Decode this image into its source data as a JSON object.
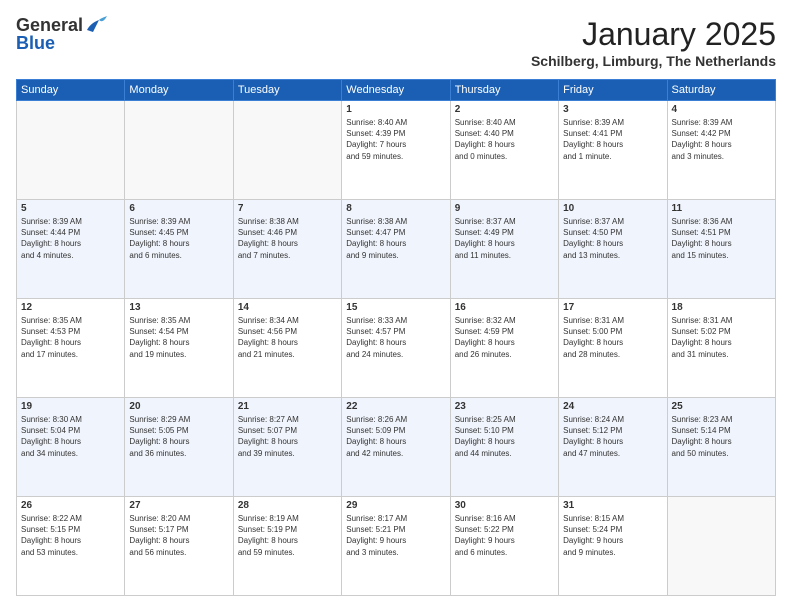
{
  "header": {
    "logo_line1": "General",
    "logo_line2": "Blue",
    "month": "January 2025",
    "location": "Schilberg, Limburg, The Netherlands"
  },
  "weekdays": [
    "Sunday",
    "Monday",
    "Tuesday",
    "Wednesday",
    "Thursday",
    "Friday",
    "Saturday"
  ],
  "weeks": [
    [
      {
        "day": "",
        "info": ""
      },
      {
        "day": "",
        "info": ""
      },
      {
        "day": "",
        "info": ""
      },
      {
        "day": "1",
        "info": "Sunrise: 8:40 AM\nSunset: 4:39 PM\nDaylight: 7 hours\nand 59 minutes."
      },
      {
        "day": "2",
        "info": "Sunrise: 8:40 AM\nSunset: 4:40 PM\nDaylight: 8 hours\nand 0 minutes."
      },
      {
        "day": "3",
        "info": "Sunrise: 8:39 AM\nSunset: 4:41 PM\nDaylight: 8 hours\nand 1 minute."
      },
      {
        "day": "4",
        "info": "Sunrise: 8:39 AM\nSunset: 4:42 PM\nDaylight: 8 hours\nand 3 minutes."
      }
    ],
    [
      {
        "day": "5",
        "info": "Sunrise: 8:39 AM\nSunset: 4:44 PM\nDaylight: 8 hours\nand 4 minutes."
      },
      {
        "day": "6",
        "info": "Sunrise: 8:39 AM\nSunset: 4:45 PM\nDaylight: 8 hours\nand 6 minutes."
      },
      {
        "day": "7",
        "info": "Sunrise: 8:38 AM\nSunset: 4:46 PM\nDaylight: 8 hours\nand 7 minutes."
      },
      {
        "day": "8",
        "info": "Sunrise: 8:38 AM\nSunset: 4:47 PM\nDaylight: 8 hours\nand 9 minutes."
      },
      {
        "day": "9",
        "info": "Sunrise: 8:37 AM\nSunset: 4:49 PM\nDaylight: 8 hours\nand 11 minutes."
      },
      {
        "day": "10",
        "info": "Sunrise: 8:37 AM\nSunset: 4:50 PM\nDaylight: 8 hours\nand 13 minutes."
      },
      {
        "day": "11",
        "info": "Sunrise: 8:36 AM\nSunset: 4:51 PM\nDaylight: 8 hours\nand 15 minutes."
      }
    ],
    [
      {
        "day": "12",
        "info": "Sunrise: 8:35 AM\nSunset: 4:53 PM\nDaylight: 8 hours\nand 17 minutes."
      },
      {
        "day": "13",
        "info": "Sunrise: 8:35 AM\nSunset: 4:54 PM\nDaylight: 8 hours\nand 19 minutes."
      },
      {
        "day": "14",
        "info": "Sunrise: 8:34 AM\nSunset: 4:56 PM\nDaylight: 8 hours\nand 21 minutes."
      },
      {
        "day": "15",
        "info": "Sunrise: 8:33 AM\nSunset: 4:57 PM\nDaylight: 8 hours\nand 24 minutes."
      },
      {
        "day": "16",
        "info": "Sunrise: 8:32 AM\nSunset: 4:59 PM\nDaylight: 8 hours\nand 26 minutes."
      },
      {
        "day": "17",
        "info": "Sunrise: 8:31 AM\nSunset: 5:00 PM\nDaylight: 8 hours\nand 28 minutes."
      },
      {
        "day": "18",
        "info": "Sunrise: 8:31 AM\nSunset: 5:02 PM\nDaylight: 8 hours\nand 31 minutes."
      }
    ],
    [
      {
        "day": "19",
        "info": "Sunrise: 8:30 AM\nSunset: 5:04 PM\nDaylight: 8 hours\nand 34 minutes."
      },
      {
        "day": "20",
        "info": "Sunrise: 8:29 AM\nSunset: 5:05 PM\nDaylight: 8 hours\nand 36 minutes."
      },
      {
        "day": "21",
        "info": "Sunrise: 8:27 AM\nSunset: 5:07 PM\nDaylight: 8 hours\nand 39 minutes."
      },
      {
        "day": "22",
        "info": "Sunrise: 8:26 AM\nSunset: 5:09 PM\nDaylight: 8 hours\nand 42 minutes."
      },
      {
        "day": "23",
        "info": "Sunrise: 8:25 AM\nSunset: 5:10 PM\nDaylight: 8 hours\nand 44 minutes."
      },
      {
        "day": "24",
        "info": "Sunrise: 8:24 AM\nSunset: 5:12 PM\nDaylight: 8 hours\nand 47 minutes."
      },
      {
        "day": "25",
        "info": "Sunrise: 8:23 AM\nSunset: 5:14 PM\nDaylight: 8 hours\nand 50 minutes."
      }
    ],
    [
      {
        "day": "26",
        "info": "Sunrise: 8:22 AM\nSunset: 5:15 PM\nDaylight: 8 hours\nand 53 minutes."
      },
      {
        "day": "27",
        "info": "Sunrise: 8:20 AM\nSunset: 5:17 PM\nDaylight: 8 hours\nand 56 minutes."
      },
      {
        "day": "28",
        "info": "Sunrise: 8:19 AM\nSunset: 5:19 PM\nDaylight: 8 hours\nand 59 minutes."
      },
      {
        "day": "29",
        "info": "Sunrise: 8:17 AM\nSunset: 5:21 PM\nDaylight: 9 hours\nand 3 minutes."
      },
      {
        "day": "30",
        "info": "Sunrise: 8:16 AM\nSunset: 5:22 PM\nDaylight: 9 hours\nand 6 minutes."
      },
      {
        "day": "31",
        "info": "Sunrise: 8:15 AM\nSunset: 5:24 PM\nDaylight: 9 hours\nand 9 minutes."
      },
      {
        "day": "",
        "info": ""
      }
    ]
  ]
}
